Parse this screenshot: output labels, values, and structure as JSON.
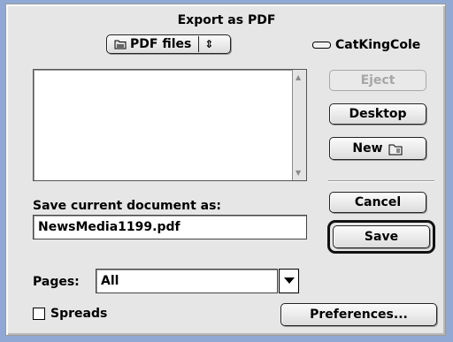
{
  "dialog": {
    "title": "Export as PDF",
    "location_menu": {
      "value": "PDF files",
      "arrow": "⇕"
    },
    "volume": {
      "name": "CatKingCole",
      "icon": "drive-icon"
    },
    "file_list": {
      "items": []
    },
    "buttons": {
      "eject": "Eject",
      "desktop": "Desktop",
      "new": "New",
      "new_icon": "folder-icon",
      "cancel": "Cancel",
      "save": "Save",
      "preferences": "Preferences..."
    },
    "save_as": {
      "label": "Save current document as:",
      "value": "NewsMedia1199.pdf"
    },
    "pages": {
      "label": "Pages:",
      "value": "All"
    },
    "spreads": {
      "label": "Spreads",
      "checked": false
    }
  },
  "colors": {
    "background": "#8fa9d4",
    "dialog": "#e6e6e6",
    "disabled_text": "#a6a6a6"
  }
}
